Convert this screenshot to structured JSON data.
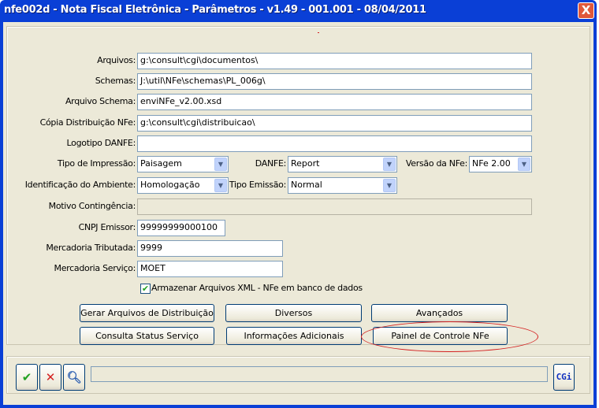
{
  "window": {
    "title": "nfe002d - Nota Fiscal Eletrônica - Parâmetros - v1.49 - 001.001 - 08/04/2011",
    "close": "X"
  },
  "fields": {
    "arquivos": {
      "label": "Arquivos:",
      "value": "g:\\consult\\cgi\\documentos\\"
    },
    "schemas": {
      "label": "Schemas:",
      "value": "J:\\util\\NFe\\schemas\\PL_006g\\"
    },
    "arquivo_schema": {
      "label": "Arquivo Schema:",
      "value": "enviNFe_v2.00.xsd"
    },
    "copia": {
      "label": "Cópia Distribuição NFe:",
      "value": "g:\\consult\\cgi\\distribuicao\\"
    },
    "logotipo": {
      "label": "Logotipo DANFE:",
      "value": ""
    },
    "tipo_impressao": {
      "label": "Tipo de Impressão:",
      "value": "Paisagem"
    },
    "danfe": {
      "label": "DANFE:",
      "value": "Report"
    },
    "versao": {
      "label": "Versão da NFe:",
      "value": "NFe 2.00"
    },
    "ambiente": {
      "label": "Identificação do Ambiente:",
      "value": "Homologação"
    },
    "tipo_emissao": {
      "label": "Tipo Emissão:",
      "value": "Normal"
    },
    "motivo": {
      "label": "Motivo Contingência:",
      "value": ""
    },
    "cnpj": {
      "label": "CNPJ Emissor:",
      "value": "99999999000100"
    },
    "merc_trib": {
      "label": "Mercadoria Tributada:",
      "value": "9999"
    },
    "merc_serv": {
      "label": "Mercadoria Serviço:",
      "value": "MOET"
    }
  },
  "checkbox": {
    "label": "Armazenar Arquivos XML - NFe em banco de dados",
    "checked": true
  },
  "buttons": [
    "Gerar Arquivos de Distribuição",
    "Diversos",
    "Avançados",
    "Consulta Status Serviço",
    "Informações Adicionais",
    "Painel de Controle NFe"
  ],
  "toolbar": {
    "cgi": "CGi",
    "progress": 0
  },
  "colors": {
    "highlight": "#d42020",
    "titlebar": "#0a3fd6"
  }
}
